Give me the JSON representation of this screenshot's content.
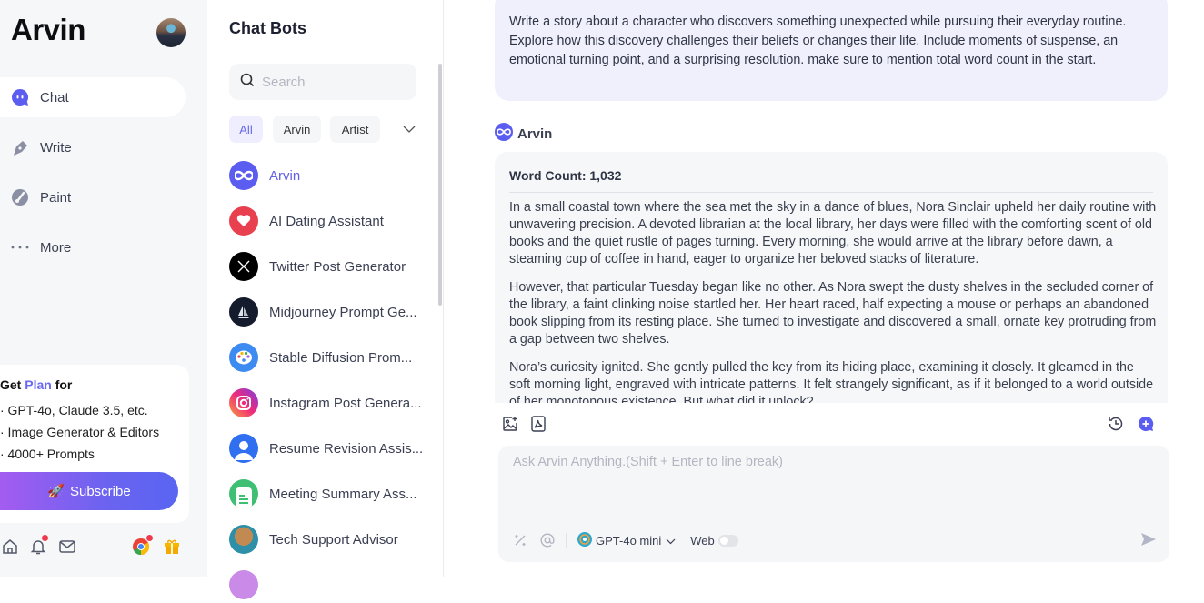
{
  "nav": {
    "brand": "Arvin",
    "items": [
      {
        "label": "Chat",
        "icon": "chat-bubble-icon",
        "active": true
      },
      {
        "label": "Write",
        "icon": "pen-nib-icon",
        "active": false
      },
      {
        "label": "Paint",
        "icon": "paint-palette-icon",
        "active": false
      },
      {
        "label": "More",
        "icon": "more-dots-icon",
        "active": false
      }
    ],
    "promo": {
      "title_pre": "Get ",
      "title_plan": "Plan",
      "title_post": " for",
      "lines": [
        "· GPT-4o, Claude 3.5, etc.",
        "· Image Generator & Editors",
        "· 4000+ Prompts"
      ],
      "subscribe_label": "Subscribe",
      "subscribe_icon": "🚀"
    },
    "bottom_icons": [
      "home-icon",
      "bell-icon",
      "mail-icon",
      "chrome-icon",
      "gift-icon"
    ]
  },
  "bots": {
    "title": "Chat Bots",
    "search_placeholder": "Search",
    "filters": [
      "All",
      "Arvin",
      "Artist"
    ],
    "active_filter": "All",
    "list": [
      {
        "name": "Arvin",
        "active": true
      },
      {
        "name": "AI Dating Assistant"
      },
      {
        "name": "Twitter Post Generator"
      },
      {
        "name": "Midjourney Prompt Ge..."
      },
      {
        "name": "Stable Diffusion Prom..."
      },
      {
        "name": "Instagram Post Genera..."
      },
      {
        "name": "Resume Revision Assis..."
      },
      {
        "name": "Meeting Summary Ass..."
      },
      {
        "name": "Tech Support Advisor"
      }
    ]
  },
  "chat": {
    "user_message": "Write a story about a character who discovers something unexpected while pursuing their everyday routine. Explore how this discovery challenges their beliefs or changes their life. Include moments of suspense, an emotional turning point, and a surprising resolution. make sure to mention total word count in the start.",
    "bot_name": "Arvin",
    "word_count": "Word Count: 1,032",
    "paragraphs": [
      "In a small coastal town where the sea met the sky in a dance of blues, Nora Sinclair upheld her daily routine with unwavering precision. A devoted librarian at the local library, her days were filled with the comforting scent of old books and the quiet rustle of pages turning. Every morning, she would arrive at the library before dawn, a steaming cup of coffee in hand, eager to organize her beloved stacks of literature.",
      "However, that particular Tuesday began like no other. As Nora swept the dusty shelves in the secluded corner of the library, a faint clinking noise startled her. Her heart raced, half expecting a mouse or perhaps an abandoned book slipping from its resting place. She turned to investigate and discovered a small, ornate key protruding from a gap between two shelves.",
      "Nora’s curiosity ignited. She gently pulled the key from its hiding place, examining it closely. It gleamed in the soft morning light, engraved with intricate patterns. It felt strangely significant, as if it belonged to a world outside of her monotonous existence. But what did it unlock?"
    ],
    "composer": {
      "placeholder": "Ask Arvin Anything.(Shift + Enter to line break)",
      "value": "",
      "model": "GPT-4o mini",
      "web_label": "Web",
      "web_enabled": false
    },
    "accent": "#5b5cf0"
  }
}
